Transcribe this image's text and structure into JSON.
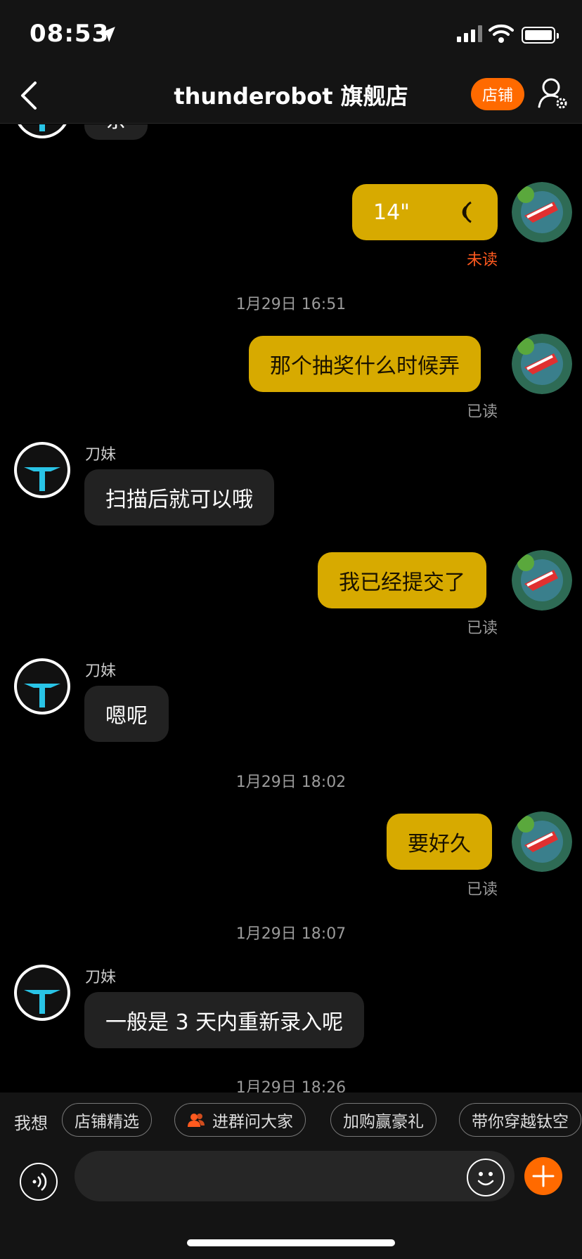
{
  "status_bar": {
    "time": "08:53"
  },
  "header": {
    "title": "thunderobot 旗舰店",
    "store_label": "店铺"
  },
  "chat": {
    "partial_top": "亲",
    "voice_message": {
      "duration": "14\"",
      "status": "未读"
    },
    "timestamps": [
      "1月29日 16:51",
      "1月29日 18:02",
      "1月29日 18:07",
      "1月29日 18:26"
    ],
    "messages": [
      {
        "from": "me",
        "text": "那个抽奖什么时候弄",
        "status": "已读"
      },
      {
        "from": "them",
        "sender": "刀妹",
        "text": "扫描后就可以哦"
      },
      {
        "from": "me",
        "text": "我已经提交了",
        "status": "已读"
      },
      {
        "from": "them",
        "sender": "刀妹",
        "text": "嗯呢"
      },
      {
        "from": "me",
        "text": "要好久",
        "status": "已读"
      },
      {
        "from": "them",
        "sender": "刀妹",
        "text": "一般是 3 天内重新录入呢"
      }
    ]
  },
  "quick_bar": {
    "label": "我想",
    "chips": [
      "店铺精选",
      "进群问大家",
      "加购赢豪礼",
      "带你穿越钛空"
    ]
  },
  "input": {
    "value": ""
  },
  "colors": {
    "accent": "#ff6a00",
    "my_bubble": "#d7aa00",
    "their_bubble": "#222222",
    "unread": "#ff5a1f"
  }
}
